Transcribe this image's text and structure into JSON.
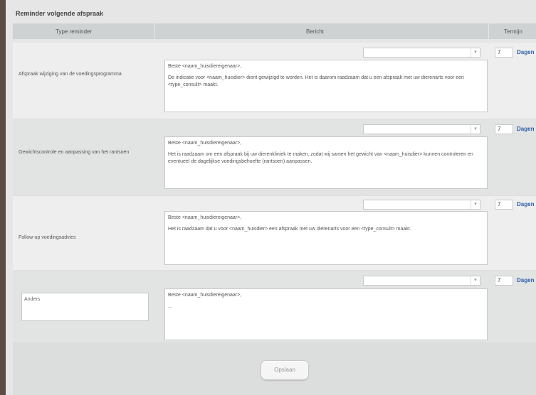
{
  "panel": {
    "title": "Reminder volgende afspraak"
  },
  "table": {
    "headers": {
      "type": "Type reminder",
      "message": "Bericht",
      "term": "Termijn"
    },
    "days_label": "Dagen",
    "rows": [
      {
        "type": "Afspraak wijziging van de voedingsprogramma",
        "select": "",
        "term": "7",
        "message": [
          "Beste <naam_huisdiereigenaar>,",
          "De indicatie voor <naam_huisdier> dient gewijzigd te worden. Het is daarom raadzaam dat u een afspraak met uw dierenarts voor een <type_consult> maakt."
        ]
      },
      {
        "type": "Gewichtscontrole en aanpassing van het rantsoen",
        "select": "",
        "term": "7",
        "message": [
          "Beste <naam_huisdiereigenaar>,",
          "Het is raadzaam om een afspraak bij uw dierenkliniek te maken, zodat wij samen het gewicht van <naam_huisdier> kunnen controleren en eventueel de dagelijkse voedingsbehoefte (rantsoen) aanpassen."
        ]
      },
      {
        "type": "Follow-up voedingsadvies",
        "select": "",
        "term": "7",
        "message": [
          "Beste <naam_huisdiereigenaar>,",
          "Het is raadzaam dat u voor <naam_huisdier> een afspraak met uw dierenarts voor een <type_consult> maakt."
        ]
      },
      {
        "type": "Anders",
        "select": "",
        "term": "7",
        "message": [
          "Beste <naam_huisdiereigenaar>,",
          "..."
        ]
      }
    ]
  },
  "footer": {
    "save_label": "Opslaan"
  }
}
